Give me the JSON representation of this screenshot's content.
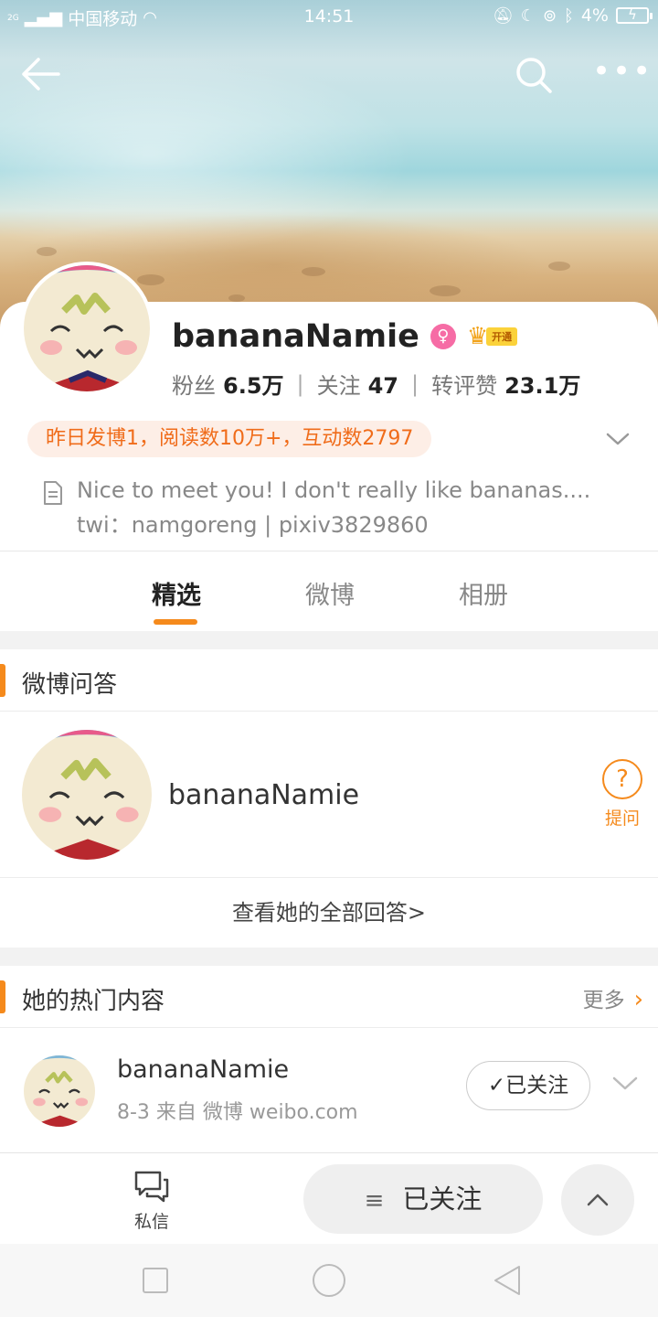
{
  "status_bar": {
    "network_type": "2G",
    "carrier": "中国移动",
    "time": "14:51",
    "battery": "4%"
  },
  "profile": {
    "name": "bananaNamie",
    "vip_label": "开通",
    "stats": [
      {
        "label": "粉丝",
        "value": "6.5万"
      },
      {
        "label": "关注",
        "value": "47"
      },
      {
        "label": "转评赞",
        "value": "23.1万"
      }
    ],
    "highlight": "昨日发博1，阅读数10万+，互动数2797",
    "bio_line1": "Nice to meet you! I don't really like bananas....",
    "bio_line2": "twi：namgoreng | pixiv3829860"
  },
  "tabs": [
    {
      "label": "精选",
      "active": true
    },
    {
      "label": "微博",
      "active": false
    },
    {
      "label": "相册",
      "active": false
    }
  ],
  "qa_section": {
    "title": "微博问答",
    "user_name": "bananaNamie",
    "ask_label": "提问",
    "see_all": "查看她的全部回答>"
  },
  "hot_section": {
    "title": "她的热门内容",
    "more_label": "更多",
    "post": {
      "author": "bananaNamie",
      "meta": "8-3  来自 微博 weibo.com",
      "follow_label": "已关注"
    }
  },
  "action_bar": {
    "dm_label": "私信",
    "followed_label": "已关注"
  },
  "colors": {
    "accent": "#f58a1c",
    "highlight_text": "#f06c1a",
    "highlight_bg": "#fdeee6",
    "gender_badge": "#f66ca5"
  },
  "icons": [
    "back-arrow-icon",
    "search-icon",
    "more-icon",
    "chevron-down-icon",
    "document-icon",
    "question-icon",
    "message-icon",
    "menu-icon",
    "chevron-up-icon"
  ]
}
